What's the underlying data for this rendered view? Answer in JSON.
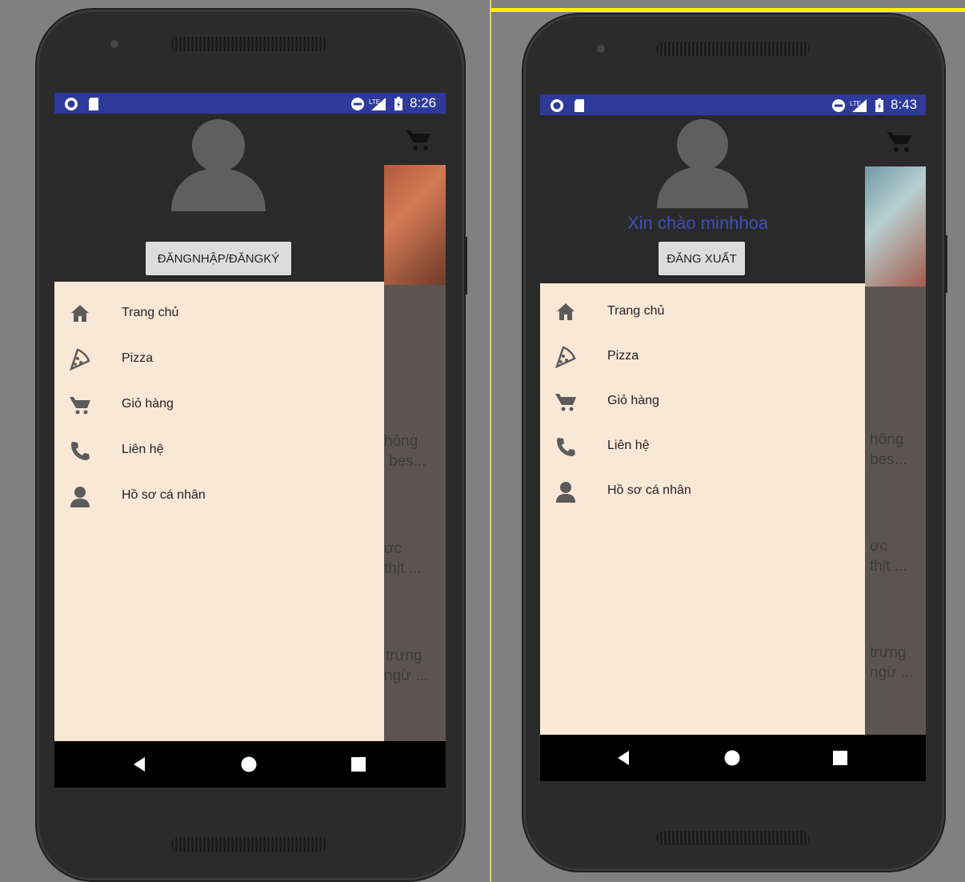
{
  "left_screen": {
    "status_time": "8:26",
    "login_button": "ĐĂNGNHẬP/ĐĂNGKÝ",
    "menu": [
      {
        "label": "Trang chủ",
        "icon": "home-icon"
      },
      {
        "label": "Pizza",
        "icon": "pizza-icon"
      },
      {
        "label": "Giỏ hàng",
        "icon": "cart-icon"
      },
      {
        "label": "Liên hệ",
        "icon": "phone-icon"
      },
      {
        "label": "Hồ sơ cá nhân",
        "icon": "person-icon"
      }
    ],
    "bg_texts": [
      "hông",
      "bes...",
      "ợc",
      "thịt ...",
      "trưng",
      "ngừ ..."
    ]
  },
  "right_screen": {
    "status_time": "8:43",
    "greeting": "Xin chào minhhoa",
    "logout_button": "ĐĂNG XUẤT",
    "menu": [
      {
        "label": "Trang chủ",
        "icon": "home-icon"
      },
      {
        "label": "Pizza",
        "icon": "pizza-icon"
      },
      {
        "label": "Giỏ hàng",
        "icon": "cart-icon"
      },
      {
        "label": "Liên hệ",
        "icon": "phone-icon"
      },
      {
        "label": "Hồ sơ cá nhân",
        "icon": "person-icon"
      }
    ],
    "bg_texts": [
      "hông",
      "bes...",
      "ợc",
      "thịt ...",
      "trưng",
      "ngừ ..."
    ]
  },
  "colors": {
    "status_bar": "#2e3a9a",
    "drawer_header": "#2a2a2a",
    "drawer_body": "#fae8d6",
    "greeting": "#3f51b5",
    "icon": "#5b5b5b"
  }
}
